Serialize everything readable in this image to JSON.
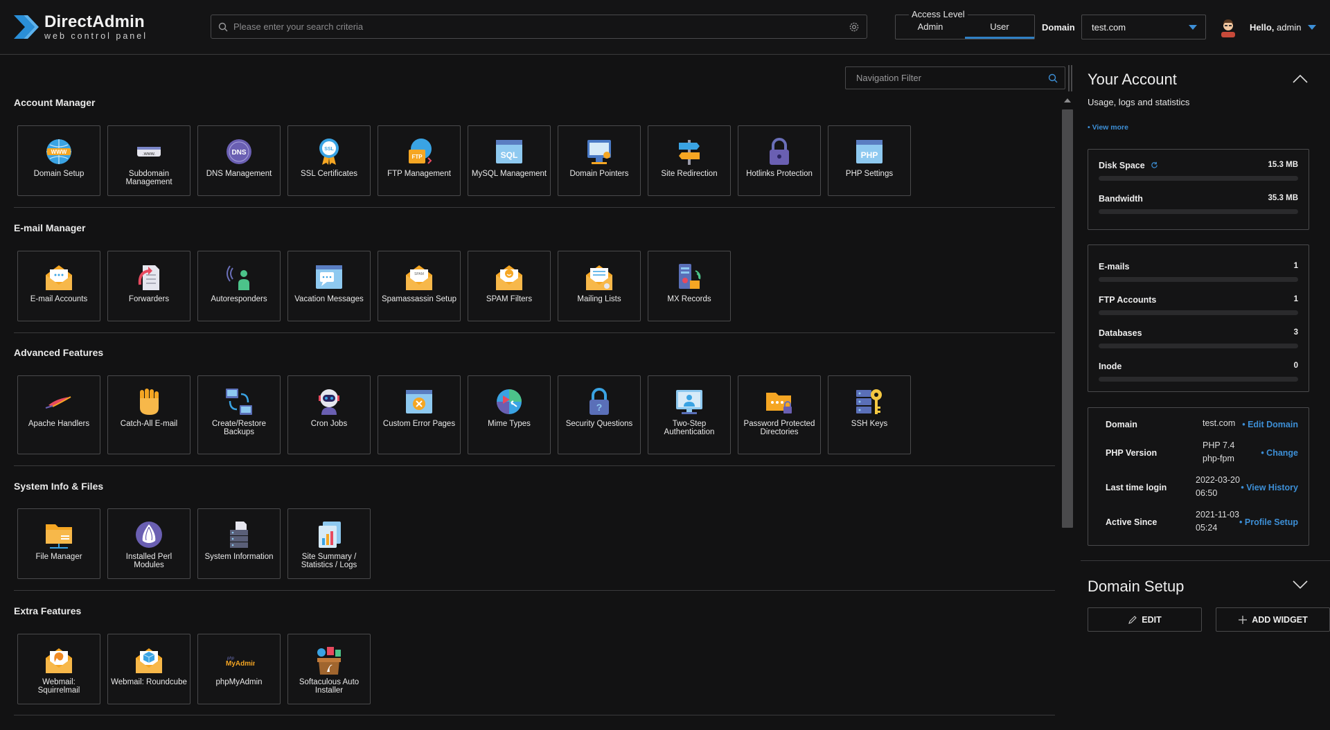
{
  "brand": {
    "name": "DirectAdmin",
    "tagline": "web control panel"
  },
  "search": {
    "placeholder": "Please enter your search criteria"
  },
  "access_level": {
    "label": "Access Level",
    "options": [
      "Admin",
      "User"
    ],
    "selected": "User"
  },
  "domain": {
    "label": "Domain",
    "selected": "test.com"
  },
  "user": {
    "greeting": "Hello,",
    "name": "admin"
  },
  "nav_filter": {
    "placeholder": "Navigation Filter"
  },
  "sections": [
    {
      "title": "Account Manager",
      "items": [
        {
          "label": "Domain Setup",
          "icon": "globe-www-icon"
        },
        {
          "label": "Subdomain Management",
          "icon": "subdomain-icon"
        },
        {
          "label": "DNS Management",
          "icon": "dns-icon"
        },
        {
          "label": "SSL Certificates",
          "icon": "ssl-badge-icon"
        },
        {
          "label": "FTP Management",
          "icon": "ftp-icon"
        },
        {
          "label": "MySQL Management",
          "icon": "sql-icon"
        },
        {
          "label": "Domain Pointers",
          "icon": "domain-pointers-icon"
        },
        {
          "label": "Site Redirection",
          "icon": "signpost-icon"
        },
        {
          "label": "Hotlinks Protection",
          "icon": "lock-icon"
        },
        {
          "label": "PHP Settings",
          "icon": "php-icon"
        }
      ]
    },
    {
      "title": "E-mail Manager",
      "items": [
        {
          "label": "E-mail Accounts",
          "icon": "envelope-icon"
        },
        {
          "label": "Forwarders",
          "icon": "forward-icon"
        },
        {
          "label": "Autoresponders",
          "icon": "autoresponder-icon"
        },
        {
          "label": "Vacation Messages",
          "icon": "vacation-icon"
        },
        {
          "label": "Spamassassin Setup",
          "icon": "spam-envelope-icon"
        },
        {
          "label": "SPAM Filters",
          "icon": "spam-filter-icon"
        },
        {
          "label": "Mailing Lists",
          "icon": "mailing-list-icon"
        },
        {
          "label": "MX Records",
          "icon": "mx-records-icon"
        }
      ]
    },
    {
      "title": "Advanced Features",
      "items": [
        {
          "label": "Apache Handlers",
          "icon": "apache-feather-icon"
        },
        {
          "label": "Catch-All E-mail",
          "icon": "fist-icon"
        },
        {
          "label": "Create/Restore Backups",
          "icon": "backup-icon"
        },
        {
          "label": "Cron Jobs",
          "icon": "robot-icon"
        },
        {
          "label": "Custom Error Pages",
          "icon": "error-page-icon"
        },
        {
          "label": "Mime Types",
          "icon": "mime-types-icon"
        },
        {
          "label": "Security Questions",
          "icon": "question-lock-icon"
        },
        {
          "label": "Two-Step Authentication",
          "icon": "two-step-icon"
        },
        {
          "label": "Password Protected Directories",
          "icon": "protected-folder-icon"
        },
        {
          "label": "SSH Keys",
          "icon": "ssh-key-icon"
        }
      ]
    },
    {
      "title": "System Info & Files",
      "items": [
        {
          "label": "File Manager",
          "icon": "folder-icon"
        },
        {
          "label": "Installed Perl Modules",
          "icon": "perl-onion-icon"
        },
        {
          "label": "System Information",
          "icon": "server-icon"
        },
        {
          "label": "Site Summary / Statistics / Logs",
          "icon": "statistics-icon"
        }
      ]
    },
    {
      "title": "Extra Features",
      "items": [
        {
          "label": "Webmail: Squirrelmail",
          "icon": "squirrelmail-icon"
        },
        {
          "label": "Webmail: Roundcube",
          "icon": "roundcube-icon"
        },
        {
          "label": "phpMyAdmin",
          "icon": "phpmyadmin-icon",
          "logo_text": [
            "php",
            "MyAdmin"
          ]
        },
        {
          "label": "Softaculous Auto Installer",
          "icon": "softaculous-icon"
        }
      ]
    }
  ],
  "account": {
    "title": "Your Account",
    "subtitle": "Usage, logs and statistics",
    "view_more": "• View more",
    "usage": [
      {
        "name": "Disk Space",
        "value": "15.3 MB",
        "fraction": 0.0
      },
      {
        "name": "Bandwidth",
        "value": "35.3 MB",
        "fraction": 0.0
      }
    ],
    "counts": [
      {
        "name": "E-mails",
        "value": "1",
        "fraction": 0.0
      },
      {
        "name": "FTP Accounts",
        "value": "1",
        "fraction": 0.0
      },
      {
        "name": "Databases",
        "value": "3",
        "fraction": 0.0
      },
      {
        "name": "Inode",
        "value": "0",
        "fraction": 0.0
      }
    ],
    "info": [
      {
        "key": "Domain",
        "value": "test.com",
        "link": "• Edit Domain"
      },
      {
        "key": "PHP Version",
        "value": "PHP 7.4 php-fpm",
        "link": "• Change"
      },
      {
        "key": "Last time login",
        "value": "2022-03-20 06:50",
        "link": "• View History"
      },
      {
        "key": "Active Since",
        "value": "2021-11-03 05:24",
        "link": "• Profile Setup"
      }
    ]
  },
  "domain_setup": {
    "title": "Domain Setup",
    "edit": "EDIT",
    "add_widget": "ADD WIDGET"
  },
  "colors": {
    "accent": "#3d8fd6",
    "background": "#121213",
    "border": "#4a4a4c"
  }
}
